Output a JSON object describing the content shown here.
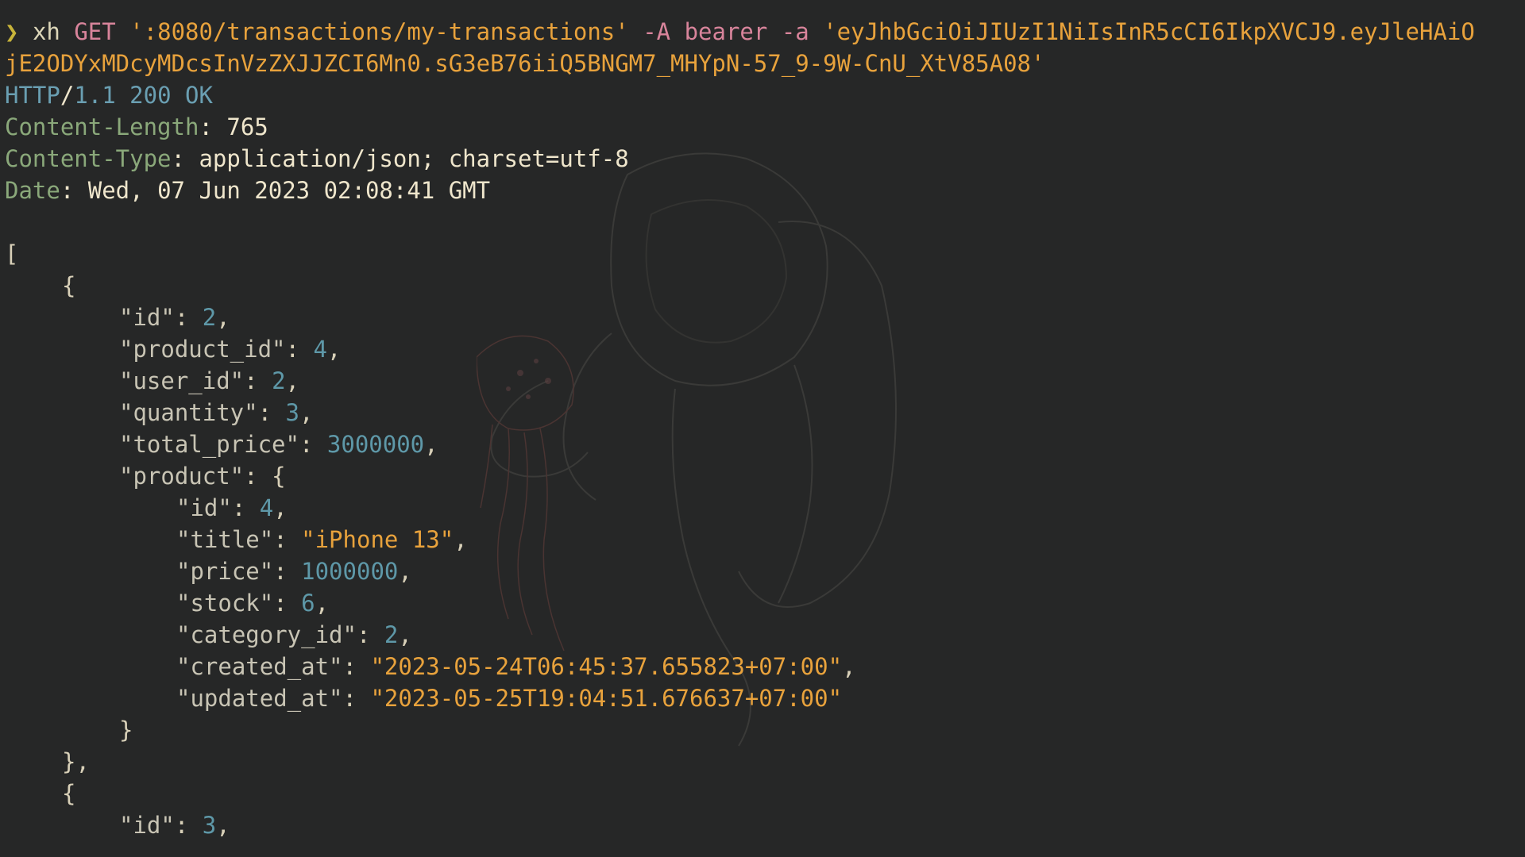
{
  "command": {
    "prompt_glyph": "❯",
    "program": "xh",
    "method": "GET",
    "url": "':8080/transactions/my-transactions'",
    "auth_type_flag": "-A",
    "auth_type": "bearer",
    "auth_flag": "-a",
    "token_part1": "'eyJhbGciOiJIUzI1NiIsInR5cCI6IkpXVCJ9.eyJleHAiO",
    "token_part2": "jE2ODYxMDcyMDcsInVzZXJJZCI6Mn0.sG3eB76iiQ5BNGM7_MHYpN-57_9-9W-CnU_XtV85A08'"
  },
  "response": {
    "status": {
      "proto": "HTTP",
      "slash": "/",
      "version": "1.1",
      "code": "200",
      "text": "OK"
    },
    "headers": [
      {
        "name": "Content-Length",
        "value": "765"
      },
      {
        "name": "Content-Type",
        "value": "application/json; charset=utf-8"
      },
      {
        "name": "Date",
        "value": "Wed, 07 Jun 2023 02:08:41 GMT"
      }
    ]
  },
  "body": {
    "open_bracket": "[",
    "open_brace": "{",
    "close_brace_comma": "},",
    "product_close": "}",
    "transaction1": {
      "id": "2",
      "product_id": "4",
      "user_id": "2",
      "quantity": "3",
      "total_price": "3000000",
      "product": {
        "id": "4",
        "title": "\"iPhone 13\"",
        "price": "1000000",
        "stock": "6",
        "category_id": "2",
        "created_at": "\"2023-05-24T06:45:37.655823+07:00\"",
        "updated_at": "\"2023-05-25T19:04:51.676637+07:00\""
      }
    },
    "transaction2": {
      "id": "3"
    },
    "keys": {
      "id": "\"id\"",
      "product_id": "\"product_id\"",
      "user_id": "\"user_id\"",
      "quantity": "\"quantity\"",
      "total_price": "\"total_price\"",
      "product": "\"product\"",
      "title": "\"title\"",
      "price": "\"price\"",
      "stock": "\"stock\"",
      "category_id": "\"category_id\"",
      "created_at": "\"created_at\"",
      "updated_at": "\"updated_at\""
    }
  },
  "colors": {
    "background": "#262727",
    "prompt": "#c8b43a",
    "keyword": "#d8849b",
    "string": "#e8a23c",
    "header_key": "#8aa87a",
    "number": "#5e98a8"
  },
  "icons": {
    "background_art": "astronaut-holding-jellyfish-illustration"
  }
}
